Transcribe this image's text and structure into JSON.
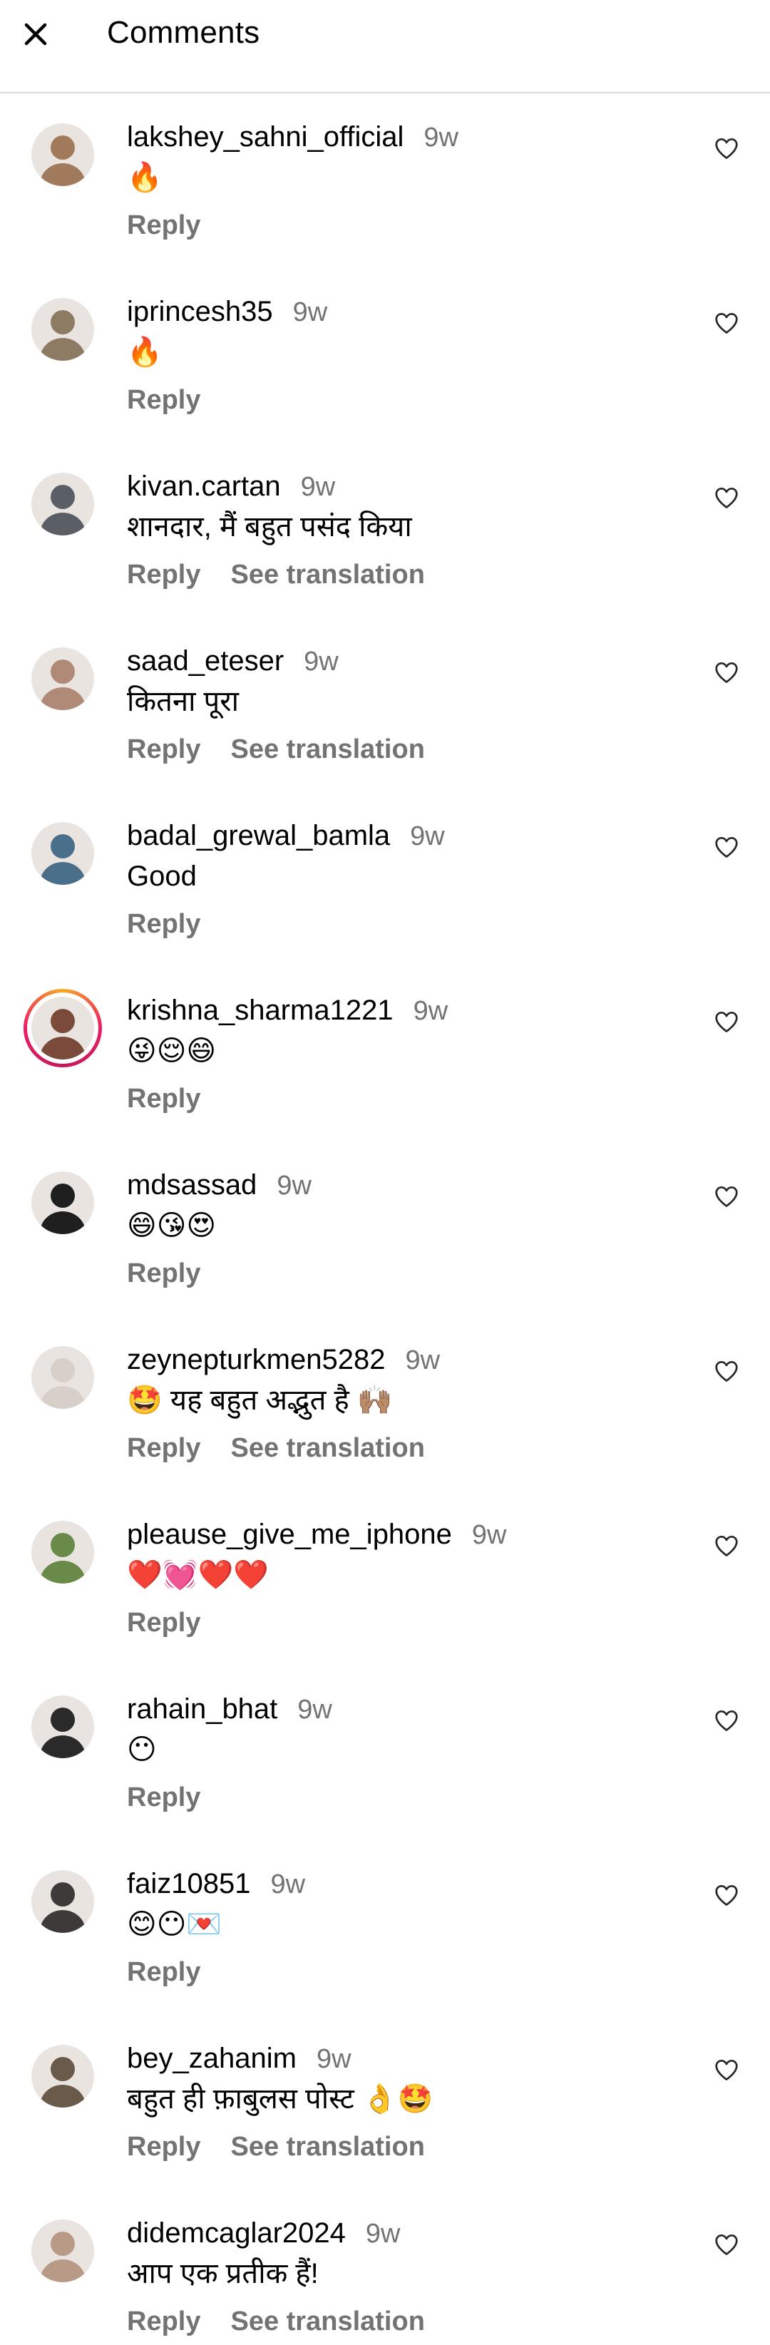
{
  "header": {
    "title": "Comments",
    "close_icon": "close-icon"
  },
  "comments": [
    {
      "username": "lakshey_sahni_official",
      "time": "9w",
      "text": "🔥",
      "reply": "Reply",
      "translation": "",
      "avatar_color": "#a07a5a"
    },
    {
      "username": "iprincesh35",
      "time": "9w",
      "text": "🔥",
      "reply": "Reply",
      "translation": "",
      "avatar_color": "#8d7b63"
    },
    {
      "username": "kivan.cartan",
      "time": "9w",
      "text": "शानदार, मैं बहुत पसंद किया",
      "reply": "Reply",
      "translation": "See translation",
      "avatar_color": "#5a5f66"
    },
    {
      "username": "saad_eteser",
      "time": "9w",
      "text": "कितना पूरा",
      "reply": "Reply",
      "translation": "See translation",
      "avatar_color": "#b08a76"
    },
    {
      "username": "badal_grewal_bamla",
      "time": "9w",
      "text": "Good",
      "reply": "Reply",
      "translation": "",
      "avatar_color": "#4a6f8a"
    },
    {
      "username": "krishna_sharma1221",
      "time": "9w",
      "text": "😜😌😄",
      "reply": "Reply",
      "translation": "",
      "avatar_color": "#7a4a3a",
      "story_ring": true
    },
    {
      "username": "mdsassad",
      "time": "9w",
      "text": "😄😘😍",
      "reply": "Reply",
      "translation": "",
      "avatar_color": "#1f1f1f"
    },
    {
      "username": "zeynepturkmen5282",
      "time": "9w",
      "text": "🤩 यह बहुत अद्भुत है 🙌🏽",
      "reply": "Reply",
      "translation": "See translation",
      "avatar_color": "#d8cfc8"
    },
    {
      "username": "pleause_give_me_iphone",
      "time": "9w",
      "text": "❤️💓❤️❤️",
      "reply": "Reply",
      "translation": "",
      "avatar_color": "#6a8a4a"
    },
    {
      "username": "rahain_bhat",
      "time": "9w",
      "text": "😶",
      "reply": "Reply",
      "translation": "",
      "avatar_color": "#2a2a2a"
    },
    {
      "username": "faiz10851",
      "time": "9w",
      "text": "😊😶💌",
      "reply": "Reply",
      "translation": "",
      "avatar_color": "#3f3a3a"
    },
    {
      "username": "bey_zahanim",
      "time": "9w",
      "text": "बहुत ही फ़ाबुलस पोस्ट 👌🤩",
      "reply": "Reply",
      "translation": "See translation",
      "avatar_color": "#6a5a4a"
    },
    {
      "username": "didemcaglar2024",
      "time": "9w",
      "text": "आप एक प्रतीक हैं!",
      "reply": "Reply",
      "translation": "See translation",
      "avatar_color": "#b89a86"
    }
  ],
  "icons": {
    "like": "heart-outline-icon"
  }
}
